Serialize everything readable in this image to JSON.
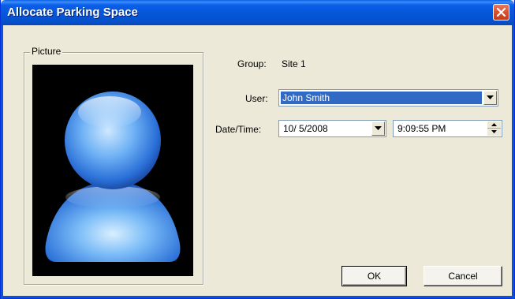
{
  "window": {
    "title": "Allocate Parking Space",
    "close_icon": "close-icon",
    "title_bar_color": "#0a5ee8",
    "close_color": "#d8512f"
  },
  "picture_group": {
    "legend": "Picture",
    "image": "person-silhouette-icon"
  },
  "form": {
    "group_label": "Group:",
    "group_value": "Site 1",
    "user_label": "User:",
    "user_value": "John Smith",
    "datetime_label": "Date/Time:",
    "date_value": "10/ 5/2008",
    "time_value": "9:09:55 PM",
    "selection_color": "#316ac5"
  },
  "buttons": {
    "ok": "OK",
    "cancel": "Cancel"
  }
}
